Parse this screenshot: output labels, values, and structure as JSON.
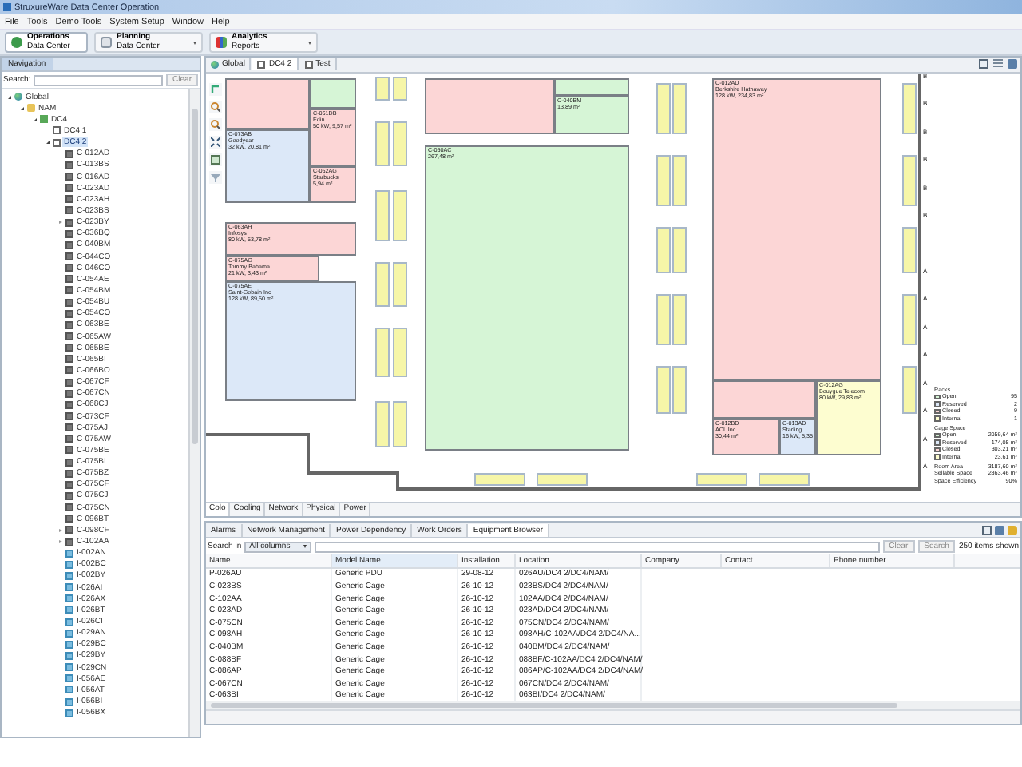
{
  "window": {
    "title": "StruxureWare Data Center Operation"
  },
  "menu": [
    "File",
    "Tools",
    "Demo Tools",
    "System Setup",
    "Window",
    "Help"
  ],
  "perspectives": [
    {
      "title": "Operations",
      "subtitle": "Data Center",
      "selected": true,
      "dropdown": false
    },
    {
      "title": "Planning",
      "subtitle": "Data Center",
      "selected": false,
      "dropdown": true
    },
    {
      "title": "Analytics",
      "subtitle": "Reports",
      "selected": false,
      "dropdown": true
    }
  ],
  "navigation": {
    "title": "Navigation",
    "search_label": "Search:",
    "clear": "Clear",
    "tree": [
      {
        "label": "Global",
        "kind": "globe",
        "expanded": true,
        "selected": false,
        "children": [
          {
            "label": "NAM",
            "kind": "folder",
            "expanded": true,
            "selected": false,
            "children": [
              {
                "label": "DC4",
                "kind": "building",
                "expanded": true,
                "selected": false,
                "children": [
                  {
                    "label": "DC4 1",
                    "kind": "floor",
                    "selected": false
                  },
                  {
                    "label": "DC4 2",
                    "kind": "floor",
                    "expanded": true,
                    "selected": true,
                    "children": [
                      {
                        "label": "C-012AD",
                        "kind": "cage",
                        "selected": false
                      },
                      {
                        "label": "C-013BS",
                        "kind": "cage",
                        "selected": false
                      },
                      {
                        "label": "C-016AD",
                        "kind": "cage",
                        "selected": false
                      },
                      {
                        "label": "C-023AD",
                        "kind": "cage",
                        "selected": false
                      },
                      {
                        "label": "C-023AH",
                        "kind": "cage",
                        "selected": false
                      },
                      {
                        "label": "C-023BS",
                        "kind": "cage",
                        "selected": false
                      },
                      {
                        "label": "C-023BY",
                        "kind": "cage",
                        "expanded": false,
                        "selected": false
                      },
                      {
                        "label": "C-036BQ",
                        "kind": "cage",
                        "selected": false
                      },
                      {
                        "label": "C-040BM",
                        "kind": "cage",
                        "selected": false
                      },
                      {
                        "label": "C-044CO",
                        "kind": "cage",
                        "selected": false
                      },
                      {
                        "label": "C-046CO",
                        "kind": "cage",
                        "selected": false
                      },
                      {
                        "label": "C-054AE",
                        "kind": "cage",
                        "selected": false
                      },
                      {
                        "label": "C-054BM",
                        "kind": "cage",
                        "selected": false
                      },
                      {
                        "label": "C-054BU",
                        "kind": "cage",
                        "selected": false
                      },
                      {
                        "label": "C-054CO",
                        "kind": "cage",
                        "selected": false
                      },
                      {
                        "label": "C-063BE",
                        "kind": "cage",
                        "selected": false
                      },
                      {
                        "label": "C-065AW",
                        "kind": "cage",
                        "selected": false
                      },
                      {
                        "label": "C-065BE",
                        "kind": "cage",
                        "selected": false
                      },
                      {
                        "label": "C-065BI",
                        "kind": "cage",
                        "selected": false
                      },
                      {
                        "label": "C-066BO",
                        "kind": "cage",
                        "selected": false
                      },
                      {
                        "label": "C-067CF",
                        "kind": "cage",
                        "selected": false
                      },
                      {
                        "label": "C-067CN",
                        "kind": "cage",
                        "selected": false
                      },
                      {
                        "label": "C-068CJ",
                        "kind": "cage",
                        "selected": false
                      },
                      {
                        "label": "C-073CF",
                        "kind": "cage",
                        "selected": false
                      },
                      {
                        "label": "C-075AJ",
                        "kind": "cage",
                        "selected": false
                      },
                      {
                        "label": "C-075AW",
                        "kind": "cage",
                        "selected": false
                      },
                      {
                        "label": "C-075BE",
                        "kind": "cage",
                        "selected": false
                      },
                      {
                        "label": "C-075BI",
                        "kind": "cage",
                        "selected": false
                      },
                      {
                        "label": "C-075BZ",
                        "kind": "cage",
                        "selected": false
                      },
                      {
                        "label": "C-075CF",
                        "kind": "cage",
                        "selected": false
                      },
                      {
                        "label": "C-075CJ",
                        "kind": "cage",
                        "selected": false
                      },
                      {
                        "label": "C-075CN",
                        "kind": "cage",
                        "selected": false
                      },
                      {
                        "label": "C-096BT",
                        "kind": "cage",
                        "selected": false
                      },
                      {
                        "label": "C-098CF",
                        "kind": "cage",
                        "expanded": false,
                        "selected": false
                      },
                      {
                        "label": "C-102AA",
                        "kind": "cage",
                        "expanded": false,
                        "selected": false
                      },
                      {
                        "label": "I-002AN",
                        "kind": "internal",
                        "selected": false
                      },
                      {
                        "label": "I-002BC",
                        "kind": "internal",
                        "selected": false
                      },
                      {
                        "label": "I-002BY",
                        "kind": "internal",
                        "selected": false
                      },
                      {
                        "label": "I-026AI",
                        "kind": "internal",
                        "selected": false
                      },
                      {
                        "label": "I-026AX",
                        "kind": "internal",
                        "selected": false
                      },
                      {
                        "label": "I-026BT",
                        "kind": "internal",
                        "selected": false
                      },
                      {
                        "label": "I-026CI",
                        "kind": "internal",
                        "selected": false
                      },
                      {
                        "label": "I-029AN",
                        "kind": "internal",
                        "selected": false
                      },
                      {
                        "label": "I-029BC",
                        "kind": "internal",
                        "selected": false
                      },
                      {
                        "label": "I-029BY",
                        "kind": "internal",
                        "selected": false
                      },
                      {
                        "label": "I-029CN",
                        "kind": "internal",
                        "selected": false
                      },
                      {
                        "label": "I-056AE",
                        "kind": "internal",
                        "selected": false
                      },
                      {
                        "label": "I-056AT",
                        "kind": "internal",
                        "selected": false
                      },
                      {
                        "label": "I-056BI",
                        "kind": "internal",
                        "selected": false
                      },
                      {
                        "label": "I-056BX",
                        "kind": "internal",
                        "selected": false
                      }
                    ]
                  }
                ]
              }
            ]
          }
        ]
      }
    ]
  },
  "editor": {
    "tabs": [
      {
        "label": "Global",
        "kind": "globe",
        "selected": false
      },
      {
        "label": "DC4 2",
        "kind": "floor",
        "selected": true
      },
      {
        "label": "Test",
        "kind": "floor",
        "selected": false
      }
    ],
    "cages": [
      {
        "color": "#fcd6d6"
      },
      {
        "color": "#d6f5d6"
      },
      {
        "color": "#fcd6d6",
        "lines": [
          "C-061DB",
          "Edin",
          "50 kW, 9,57 m²"
        ]
      },
      {
        "color": "#dce8f8",
        "lines": [
          "C-073AB",
          "Goodyear",
          "32 kW, 20,81 m²"
        ]
      },
      {
        "color": "#fcd6d6",
        "lines": [
          "C-062AG",
          "Starbucks",
          "5,94 m²"
        ]
      },
      {
        "color": "#fcd6d6",
        "lines": [
          "C-063AH",
          "Infosys",
          "80 kW, 53,78 m²"
        ]
      },
      {
        "color": "#fcd6d6",
        "lines": [
          "C-075AG",
          "Tommy Bahama",
          "21 kW, 3,43 m²"
        ]
      },
      {
        "color": "#dce8f8",
        "lines": [
          "C-075AE",
          "Saint-Gobain Inc",
          "128 kW, 89,50 m²"
        ]
      },
      {
        "color": "#fcd6d6"
      },
      {
        "color": "#d6f5d6"
      },
      {
        "color": "#d6f5d6",
        "lines": [
          "C-040BM",
          "13,89 m²"
        ]
      },
      {
        "color": "#d6f5d6",
        "lines": [
          "C-050AC",
          "267,48 m²"
        ]
      },
      {
        "color": "#fcd6d6",
        "lines": [
          "C-012AD",
          "Berkshire Hathaway",
          "128 kW, 234,83 m²"
        ]
      },
      {
        "color": "#fcd6d6"
      },
      {
        "color": "#fcd6d6",
        "lines": [
          "C-012BD",
          "ACL Inc",
          "30,44 m²"
        ]
      },
      {
        "color": "#dce8f8",
        "lines": [
          "C-013AD",
          "Starling",
          "16 kW, 5,35"
        ]
      },
      {
        "color": "#fdfdd0",
        "lines": [
          "C-012AG",
          "Bouygue Telecom",
          "80 kW, 29,83 m²"
        ]
      }
    ],
    "row_letters": [
      "B",
      "B",
      "B",
      "B",
      "B",
      "B",
      "A",
      "A",
      "A",
      "A",
      "A",
      "A",
      "A",
      "A"
    ],
    "legend": [
      {
        "title": "Racks",
        "items": [
          {
            "label": "Open",
            "value": "95",
            "color": "#d6f5d6"
          },
          {
            "label": "Reserved",
            "value": "2",
            "color": "#dce8f8"
          },
          {
            "label": "Closed",
            "value": "9",
            "color": "#fcd6d6"
          },
          {
            "label": "Internal",
            "value": "1",
            "color": "#fdfdd0"
          }
        ]
      },
      {
        "title": "Cage Space",
        "items": [
          {
            "label": "Open",
            "value": "2059,64 m²",
            "color": "#d6f5d6"
          },
          {
            "label": "Reserved",
            "value": "174,08 m²",
            "color": "#dce8f8"
          },
          {
            "label": "Closed",
            "value": "303,21 m²",
            "color": "#fcd6d6"
          },
          {
            "label": "Internal",
            "value": "23,61 m²",
            "color": "#fdfdd0"
          }
        ]
      }
    ],
    "summary": [
      {
        "label": "Room Area",
        "value": "3187,60 m²"
      },
      {
        "label": "Sellable Space",
        "value": "2863,46 m²"
      },
      {
        "label": "Space Efficiency",
        "value": "90%"
      }
    ],
    "view_tabs": [
      {
        "label": "Colo",
        "selected": true
      },
      {
        "label": "Cooling",
        "selected": false
      },
      {
        "label": "Network",
        "selected": false
      },
      {
        "label": "Physical",
        "selected": false
      },
      {
        "label": "Power",
        "selected": false
      }
    ]
  },
  "bottom": {
    "tabs": [
      {
        "label": "Alarms",
        "selected": false
      },
      {
        "label": "Network Management",
        "selected": false
      },
      {
        "label": "Power Dependency",
        "selected": false
      },
      {
        "label": "Work Orders",
        "selected": false
      },
      {
        "label": "Equipment Browser",
        "selected": true
      }
    ],
    "search_label": "Search in",
    "scope": "All columns",
    "clear": "Clear",
    "search": "Search",
    "count": "250 items shown",
    "columns": [
      "Name",
      "Model Name",
      "Installation ...",
      "Location",
      "Company",
      "Contact",
      "Phone number"
    ],
    "rows": [
      [
        "P-026AU",
        "Generic PDU",
        "29-08-12",
        "026AU/DC4 2/DC4/NAM/"
      ],
      [
        "C-023BS",
        "Generic Cage",
        "26-10-12",
        "023BS/DC4 2/DC4/NAM/"
      ],
      [
        "C-102AA",
        "Generic Cage",
        "26-10-12",
        "102AA/DC4 2/DC4/NAM/"
      ],
      [
        "C-023AD",
        "Generic Cage",
        "26-10-12",
        "023AD/DC4 2/DC4/NAM/"
      ],
      [
        "C-075CN",
        "Generic Cage",
        "26-10-12",
        "075CN/DC4 2/DC4/NAM/"
      ],
      [
        "C-098AH",
        "Generic Cage",
        "26-10-12",
        "098AH/C-102AA/DC4 2/DC4/NA..."
      ],
      [
        "C-040BM",
        "Generic Cage",
        "26-10-12",
        "040BM/DC4 2/DC4/NAM/"
      ],
      [
        "C-088BF",
        "Generic Cage",
        "26-10-12",
        "088BF/C-102AA/DC4 2/DC4/NAM/"
      ],
      [
        "C-086AP",
        "Generic Cage",
        "26-10-12",
        "086AP/C-102AA/DC4 2/DC4/NAM/"
      ],
      [
        "C-067CN",
        "Generic Cage",
        "26-10-12",
        "067CN/DC4 2/DC4/NAM/"
      ],
      [
        "C-063BI",
        "Generic Cage",
        "26-10-12",
        "063BI/DC4 2/DC4/NAM/"
      ]
    ]
  }
}
